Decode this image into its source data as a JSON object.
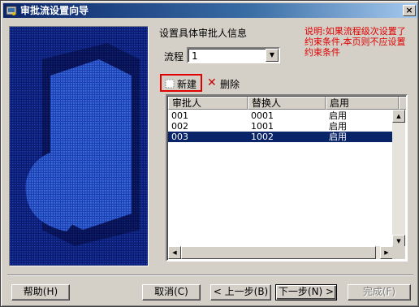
{
  "window": {
    "title": "审批流设置向导",
    "close_label": "×"
  },
  "section_title": "设置具体审批人信息",
  "note": "说明:如果流程级次设置了约束条件,本页则不应设置约束条件",
  "flow": {
    "label": "流程",
    "value": "1"
  },
  "toolbar": {
    "new_label": "新建",
    "delete_label": "删除"
  },
  "table": {
    "columns": [
      "审批人",
      "替换人",
      "启用"
    ],
    "rows": [
      {
        "approver": "001",
        "substitute": "0001",
        "enabled": "启用",
        "selected": false
      },
      {
        "approver": "002",
        "substitute": "1001",
        "enabled": "启用",
        "selected": false
      },
      {
        "approver": "003",
        "substitute": "1002",
        "enabled": "启用",
        "selected": true
      }
    ]
  },
  "buttons": {
    "help": "帮助(H)",
    "cancel": "取消(C)",
    "back": "< 上一步(B)",
    "next": "下一步(N) >",
    "finish": "完成(F)"
  },
  "colors": {
    "title_bar": "#0a246a",
    "note_text": "#e00000",
    "selection": "#0a246a",
    "side_panel": "#0a1a6e"
  }
}
